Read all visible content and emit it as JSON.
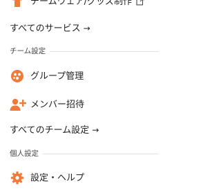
{
  "menu": {
    "team_ware_label": "チームウェア/グッズ制作",
    "all_services_label": "すべてのサービス",
    "arrow": "→",
    "team_settings_title": "チーム設定",
    "group_manage_label": "グループ管理",
    "invite_member_label": "メンバー招待",
    "all_team_settings_label": "すべてのチーム設定",
    "personal_settings_title": "個人設定",
    "settings_help_label": "設定・ヘルプ"
  },
  "colors": {
    "accent": "#f07a3a",
    "text": "#222222",
    "divider": "#e2e2e2"
  },
  "icons": {
    "team_ware": "shirt-icon",
    "external": "external-link-icon",
    "group_manage": "group-circle-icon",
    "invite_member": "person-add-icon",
    "settings_help": "gear-icon"
  }
}
